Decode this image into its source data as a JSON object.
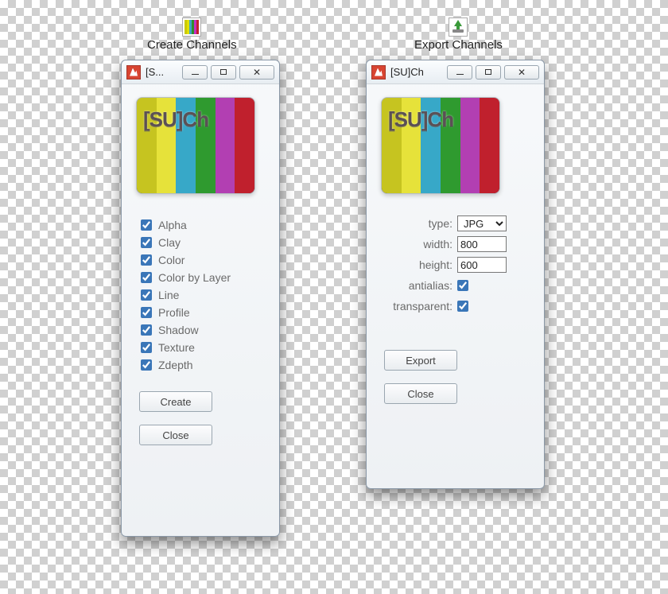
{
  "tools": {
    "create": {
      "label": "Create Channels"
    },
    "export": {
      "label": "Export Channels"
    }
  },
  "create_window": {
    "title": "[S...",
    "logo_text": "[SU]Ch",
    "channels": [
      {
        "label": "Alpha",
        "checked": true
      },
      {
        "label": "Clay",
        "checked": true
      },
      {
        "label": "Color",
        "checked": true
      },
      {
        "label": "Color by Layer",
        "checked": true
      },
      {
        "label": "Line",
        "checked": true
      },
      {
        "label": "Profile",
        "checked": true
      },
      {
        "label": "Shadow",
        "checked": true
      },
      {
        "label": "Texture",
        "checked": true
      },
      {
        "label": "Zdepth",
        "checked": true
      }
    ],
    "buttons": {
      "create": "Create",
      "close": "Close"
    }
  },
  "export_window": {
    "title": "[SU]Ch",
    "logo_text": "[SU]Ch",
    "fields": {
      "type": {
        "label": "type:",
        "value": "JPG",
        "options": [
          "JPG"
        ]
      },
      "width": {
        "label": "width:",
        "value": "800"
      },
      "height": {
        "label": "height:",
        "value": "600"
      },
      "antialias": {
        "label": "antialias:",
        "checked": true
      },
      "transparent": {
        "label": "transparent:",
        "checked": true
      }
    },
    "buttons": {
      "export": "Export",
      "close": "Close"
    }
  }
}
